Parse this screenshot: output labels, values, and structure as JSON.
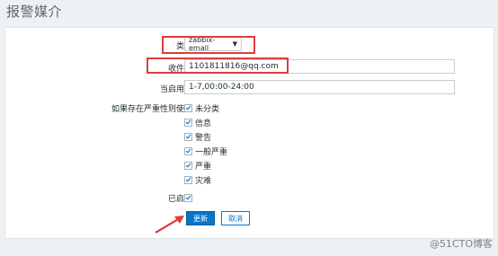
{
  "page": {
    "title": "报警媒介"
  },
  "form": {
    "type": {
      "label": "类型",
      "value": "zabbix-email"
    },
    "recipient": {
      "label": "收件人",
      "value": "1101811816@qq.com"
    },
    "active_time": {
      "label": "当启用时",
      "value": "1-7,00:00-24:00"
    },
    "severity": {
      "label": "如果存在严重性则使用",
      "options": [
        "未分类",
        "信息",
        "警告",
        "一般严重",
        "严重",
        "灾难"
      ],
      "checked": [
        true,
        true,
        true,
        true,
        true,
        true
      ]
    },
    "enabled": {
      "label": "已启用",
      "checked": true
    },
    "buttons": {
      "update": "更新",
      "cancel": "取消"
    }
  },
  "colors": {
    "highlight": "#e03c3c",
    "primary": "#0a75c9"
  },
  "watermark": "@51CTO博客"
}
